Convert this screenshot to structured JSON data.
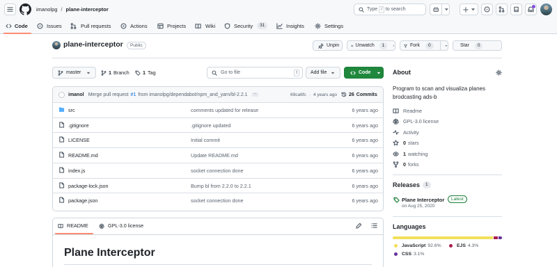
{
  "header": {
    "owner": "imanolpg",
    "separator": "/",
    "repo": "plane-interceptor",
    "search_placeholder": "Type / to search",
    "search_prefix": "Type",
    "search_key": "/",
    "search_suffix": "to search"
  },
  "tabs": [
    {
      "label": "Code",
      "icon": "code-icon",
      "count": ""
    },
    {
      "label": "Issues",
      "icon": "issue-icon",
      "count": ""
    },
    {
      "label": "Pull requests",
      "icon": "pull-request-icon",
      "count": ""
    },
    {
      "label": "Actions",
      "icon": "play-icon",
      "count": ""
    },
    {
      "label": "Projects",
      "icon": "table-icon",
      "count": ""
    },
    {
      "label": "Wiki",
      "icon": "book-icon",
      "count": ""
    },
    {
      "label": "Security",
      "icon": "shield-icon",
      "count": "31"
    },
    {
      "label": "Insights",
      "icon": "graph-icon",
      "count": ""
    },
    {
      "label": "Settings",
      "icon": "gear-icon",
      "count": ""
    }
  ],
  "repo_header": {
    "name": "plane-interceptor",
    "visibility": "Public",
    "unpin": "Unpin",
    "unwatch": "Unwatch",
    "watch_count": "1",
    "fork": "Fork",
    "fork_count": "0",
    "star": "Star",
    "star_count": "0"
  },
  "toolbar": {
    "branch": "master",
    "branches_count": "1",
    "branches_label": "Branch",
    "tags_count": "1",
    "tags_label": "Tag",
    "goto_placeholder": "Go to file",
    "goto_key": "t",
    "add_file": "Add file",
    "code": "Code"
  },
  "commit": {
    "author": "imanol",
    "message_prefix": "Merge pull request",
    "pr": "#1",
    "message_suffix": "from imanolpg/dependabot/npm_and_yarn/bl-2.2.1",
    "sha": "69ca6fc",
    "age": "4 years ago",
    "commits_count": "26",
    "commits_label": "Commits"
  },
  "files": [
    {
      "name": "src",
      "type": "folder",
      "message": "comments updated for release",
      "age": "6 years ago"
    },
    {
      "name": ".gitignore",
      "type": "file",
      "message": ".gitignore updated",
      "age": "6 years ago"
    },
    {
      "name": "LICENSE",
      "type": "file",
      "message": "Initial commit",
      "age": "6 years ago"
    },
    {
      "name": "README.md",
      "type": "file",
      "message": "Update README.md",
      "age": "6 years ago"
    },
    {
      "name": "index.js",
      "type": "file",
      "message": "socket connection done",
      "age": "6 years ago"
    },
    {
      "name": "package-lock.json",
      "type": "file",
      "message": "Bump bl from 2.2.0 to 2.2.1",
      "age": "6 years ago"
    },
    {
      "name": "package.json",
      "type": "file",
      "message": "socket connection done",
      "age": "6 years ago"
    }
  ],
  "readme": {
    "tab_readme": "README",
    "tab_license": "GPL-3.0 license",
    "title": "Plane Interceptor"
  },
  "about": {
    "heading": "About",
    "description": "Program to scan and visualiza planes brodcasting ads-b",
    "links": [
      {
        "label": "Readme",
        "icon": "book-icon",
        "count": ""
      },
      {
        "label": "GPL-3.0 license",
        "icon": "law-icon",
        "count": ""
      },
      {
        "label": "Activity",
        "icon": "pulse-icon",
        "count": ""
      },
      {
        "label": "stars",
        "icon": "star-icon",
        "count": "0"
      },
      {
        "label": "watching",
        "icon": "eye-icon",
        "count": "1"
      },
      {
        "label": "forks",
        "icon": "fork-icon",
        "count": "0"
      }
    ]
  },
  "releases": {
    "heading": "Releases",
    "count": "1",
    "name": "Plane Interceptor",
    "badge": "Latest",
    "date": "on Aug 25, 2020"
  },
  "languages": {
    "heading": "Languages",
    "items": [
      {
        "name": "JavaScript",
        "percent": "92.6%",
        "value": 92.6,
        "color": "#f1e05a"
      },
      {
        "name": "EJS",
        "percent": "4.3%",
        "value": 4.3,
        "color": "#a91e50"
      },
      {
        "name": "CSS",
        "percent": "3.1%",
        "value": 3.1,
        "color": "#663399"
      }
    ]
  },
  "colors": {
    "accent": "#fd8c73",
    "primary_button": "#1f883d",
    "folder": "#54aeff",
    "link": "#0969da",
    "latest_badge": "#1a7f37"
  }
}
